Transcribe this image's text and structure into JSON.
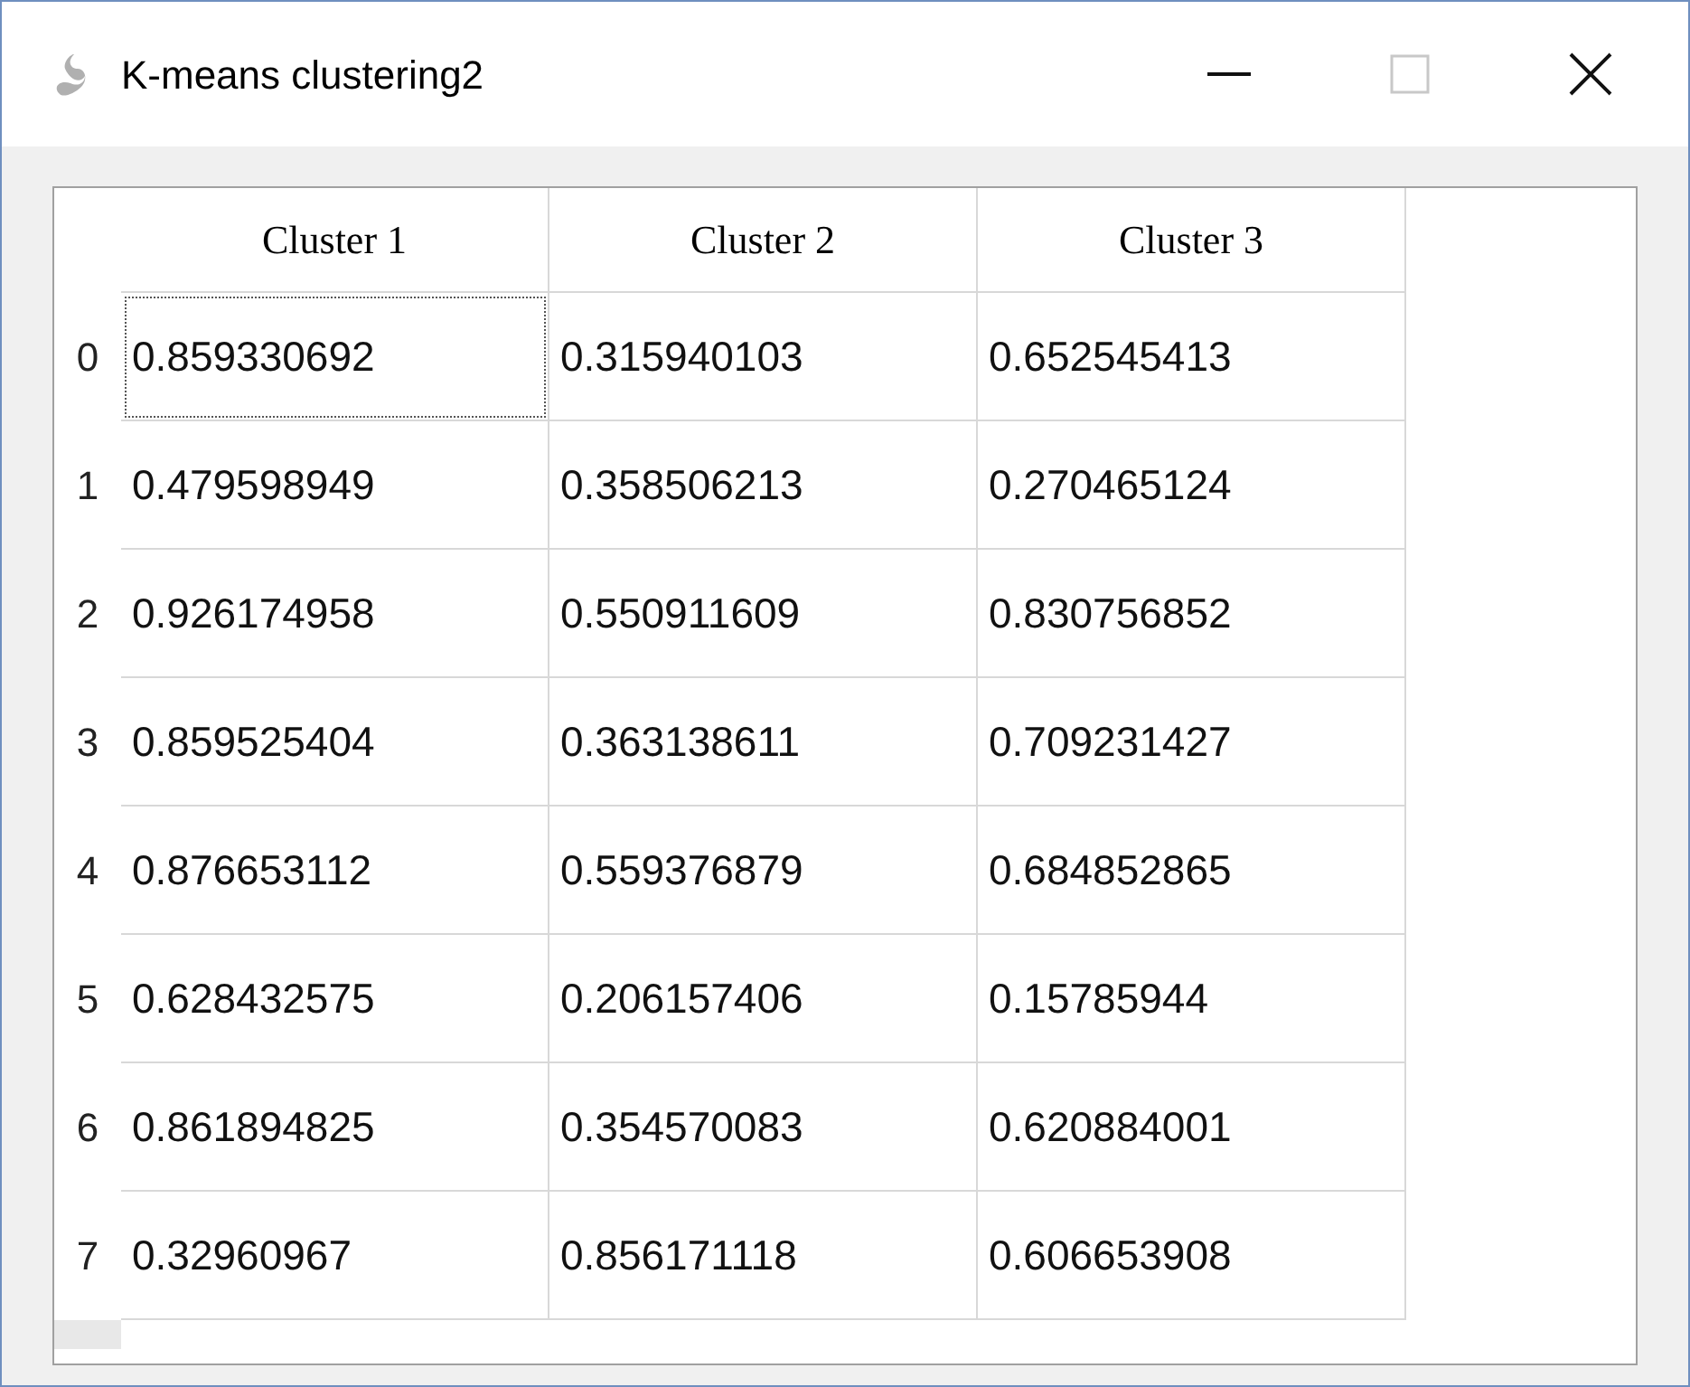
{
  "window": {
    "title": "K-means clustering2",
    "maximize_disabled": true
  },
  "table": {
    "columns": [
      "Cluster 1",
      "Cluster 2",
      "Cluster 3"
    ],
    "rows": [
      {
        "header": "0",
        "cells": [
          {
            "text": "0.859330692",
            "selected": true
          },
          {
            "text": "0.315940103",
            "selected": false
          },
          {
            "text": "0.652545413",
            "selected": false
          }
        ]
      },
      {
        "header": "1",
        "cells": [
          {
            "text": "0.479598949",
            "selected": false
          },
          {
            "text": "0.358506213",
            "selected": false
          },
          {
            "text": "0.270465124",
            "selected": false
          }
        ]
      },
      {
        "header": "2",
        "cells": [
          {
            "text": "0.926174958",
            "selected": false
          },
          {
            "text": "0.550911609",
            "selected": false
          },
          {
            "text": "0.830756852",
            "selected": false
          }
        ]
      },
      {
        "header": "3",
        "cells": [
          {
            "text": "0.859525404",
            "selected": false
          },
          {
            "text": "0.363138611",
            "selected": false
          },
          {
            "text": "0.709231427",
            "selected": false
          }
        ]
      },
      {
        "header": "4",
        "cells": [
          {
            "text": "0.876653112",
            "selected": false
          },
          {
            "text": "0.559376879",
            "selected": false
          },
          {
            "text": "0.684852865",
            "selected": false
          }
        ]
      },
      {
        "header": "5",
        "cells": [
          {
            "text": "0.628432575",
            "selected": false
          },
          {
            "text": "0.206157406",
            "selected": false
          },
          {
            "text": "0.15785944",
            "selected": false
          }
        ]
      },
      {
        "header": "6",
        "cells": [
          {
            "text": "0.861894825",
            "selected": false
          },
          {
            "text": "0.354570083",
            "selected": false
          },
          {
            "text": "0.620884001",
            "selected": false
          }
        ]
      },
      {
        "header": "7",
        "cells": [
          {
            "text": "0.32960967",
            "selected": false
          },
          {
            "text": "0.856171118",
            "selected": false
          },
          {
            "text": "0.606653908",
            "selected": false
          }
        ]
      }
    ]
  }
}
